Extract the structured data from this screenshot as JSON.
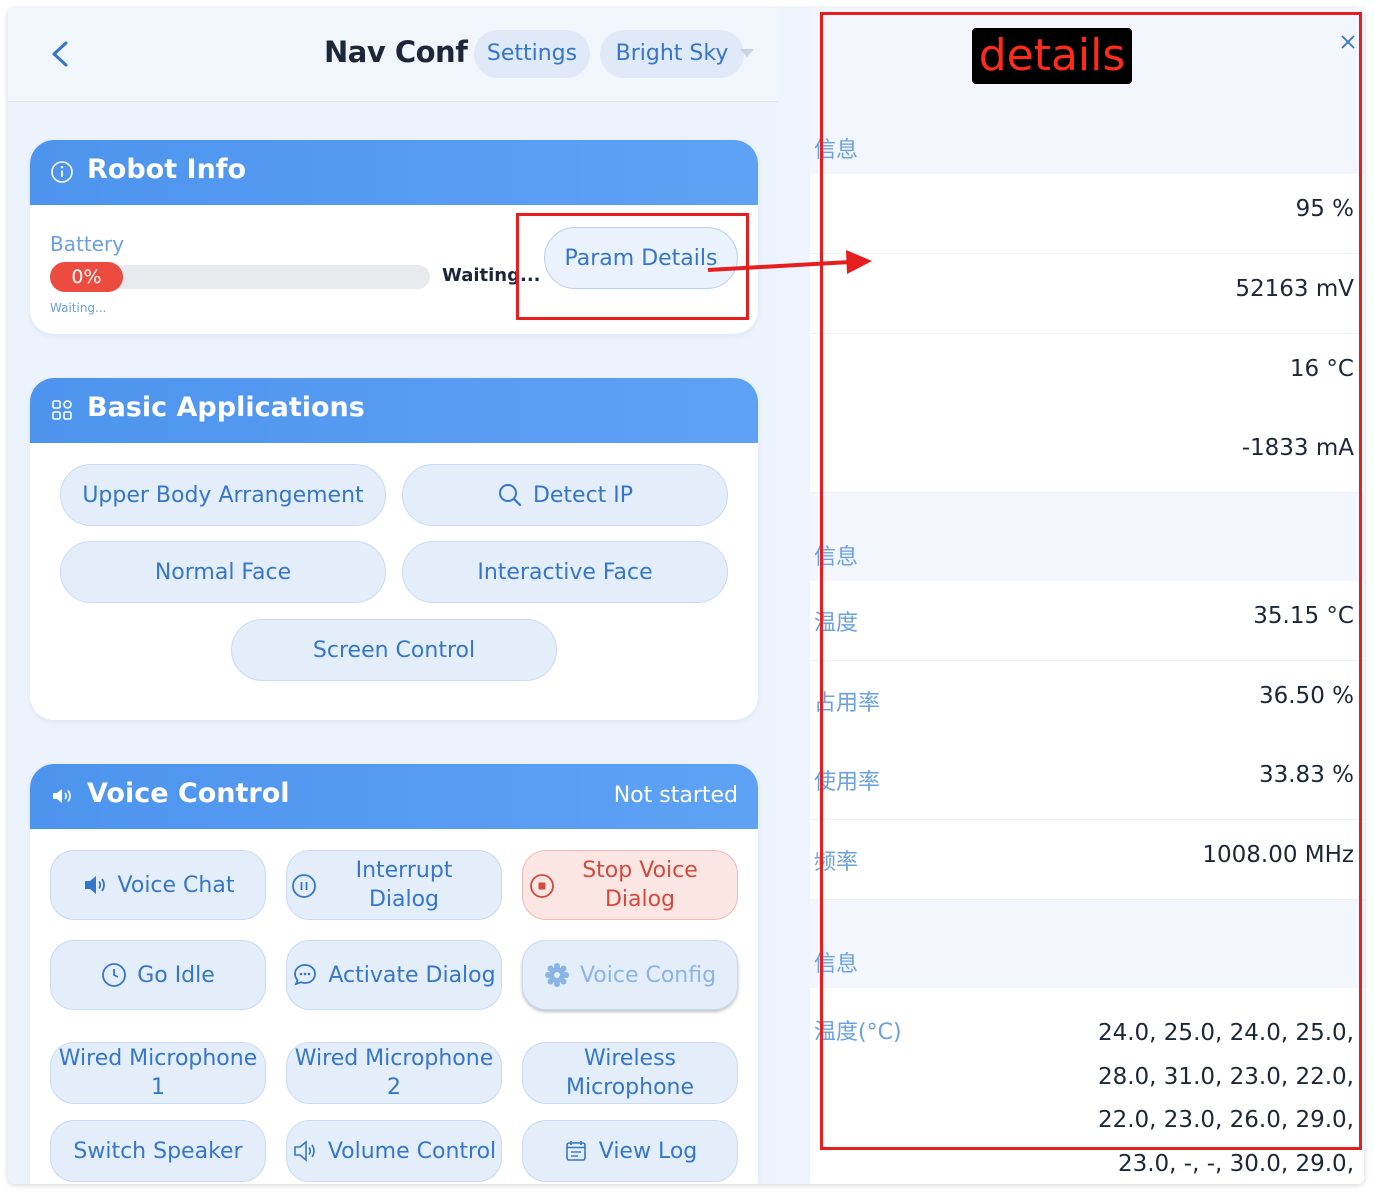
{
  "header": {
    "title": "Nav Conf",
    "settings_label": "Settings",
    "theme_label": "Bright Sky"
  },
  "robot_info": {
    "title": "Robot Info",
    "battery_label": "Battery",
    "battery_percent_text": "0%",
    "battery_level": 0,
    "battery_subtext": "Waiting...",
    "battery_status": "Waiting...",
    "param_details_label": "Param Details"
  },
  "basic_apps": {
    "title": "Basic Applications",
    "buttons": [
      "Upper Body Arrangement",
      "Detect IP",
      "Normal Face",
      "Interactive Face",
      "Screen Control"
    ]
  },
  "voice_control": {
    "title": "Voice Control",
    "status": "Not started",
    "buttons": {
      "voice_chat": "Voice Chat",
      "interrupt_dialog": "Interrupt Dialog",
      "stop_voice_dialog": "Stop Voice Dialog",
      "go_idle": "Go Idle",
      "activate_dialog": "Activate Dialog",
      "voice_config": "Voice Config",
      "wired_mic_1": "Wired Microphone 1",
      "wired_mic_2": "Wired Microphone 2",
      "wireless_mic": "Wireless Microphone",
      "switch_speaker": "Switch Speaker",
      "volume_control": "Volume Control",
      "view_log": "View Log"
    }
  },
  "details_panel": {
    "section1_title": "信息",
    "battery_rows": [
      {
        "label": "",
        "value": "95 %"
      },
      {
        "label": "",
        "value": "52163 mV"
      },
      {
        "label": "",
        "value": "16 °C"
      },
      {
        "label": "",
        "value": "-1833 mA"
      }
    ],
    "section2_title": "信息",
    "cpu_rows": [
      {
        "label": "温度",
        "value": "35.15 °C"
      },
      {
        "label": "占用率",
        "value": "36.50 %"
      },
      {
        "label": "使用率",
        "value": "33.83 %"
      },
      {
        "label": "频率",
        "value": "1008.00 MHz"
      }
    ],
    "section3_title": "信息",
    "temp_label": "温度(°C)",
    "temp_values": "24.0, 25.0, 24.0, 25.0, 28.0, 31.0, 23.0, 22.0, 22.0, 23.0, 26.0, 29.0, 23.0, -, -, 30.0, 29.0,"
  },
  "annotation": {
    "label": "details",
    "color": "#e61e1e"
  }
}
